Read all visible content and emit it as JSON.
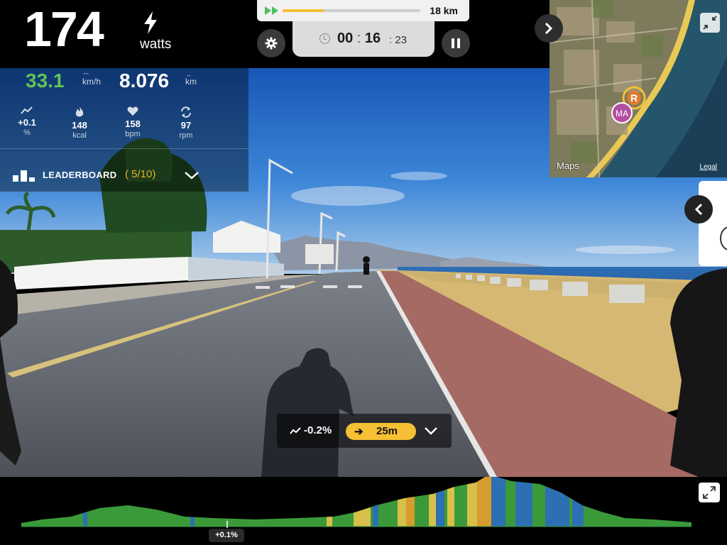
{
  "power": {
    "value": "174",
    "unit": "watts",
    "icon": "lightning-bolt-icon"
  },
  "route_progress": {
    "distance_label": "18 km",
    "fraction_complete": 0.3,
    "colors": {
      "fill": "#f6c032",
      "play": "#4cc05b"
    }
  },
  "timer": {
    "hours_minutes": "00",
    "minutes": "16",
    "seconds": "23"
  },
  "metrics": {
    "speed": {
      "value": "33.1",
      "unit": "km/h",
      "color": "#5fc456"
    },
    "distance": {
      "value": "8.076",
      "unit": "km"
    },
    "stats": [
      {
        "icon": "incline-icon",
        "value": "+0.1",
        "unit": "%"
      },
      {
        "icon": "flame-icon",
        "value": "148",
        "unit": "kcal"
      },
      {
        "icon": "heart-icon",
        "value": "158",
        "unit": "bpm"
      },
      {
        "icon": "cadence-icon",
        "value": "97",
        "unit": "rpm"
      }
    ]
  },
  "leaderboard": {
    "label": "LEADERBOARD",
    "rank": "5",
    "total": "/10"
  },
  "map": {
    "attribution": "Maps",
    "legal": "Legal",
    "rider_initials": "MA"
  },
  "gradient_pill": {
    "gradient": "-0.2%",
    "distance": "25m"
  },
  "profile": {
    "position_gradient": "+0.1%",
    "marker_position_fraction": 0.313
  }
}
